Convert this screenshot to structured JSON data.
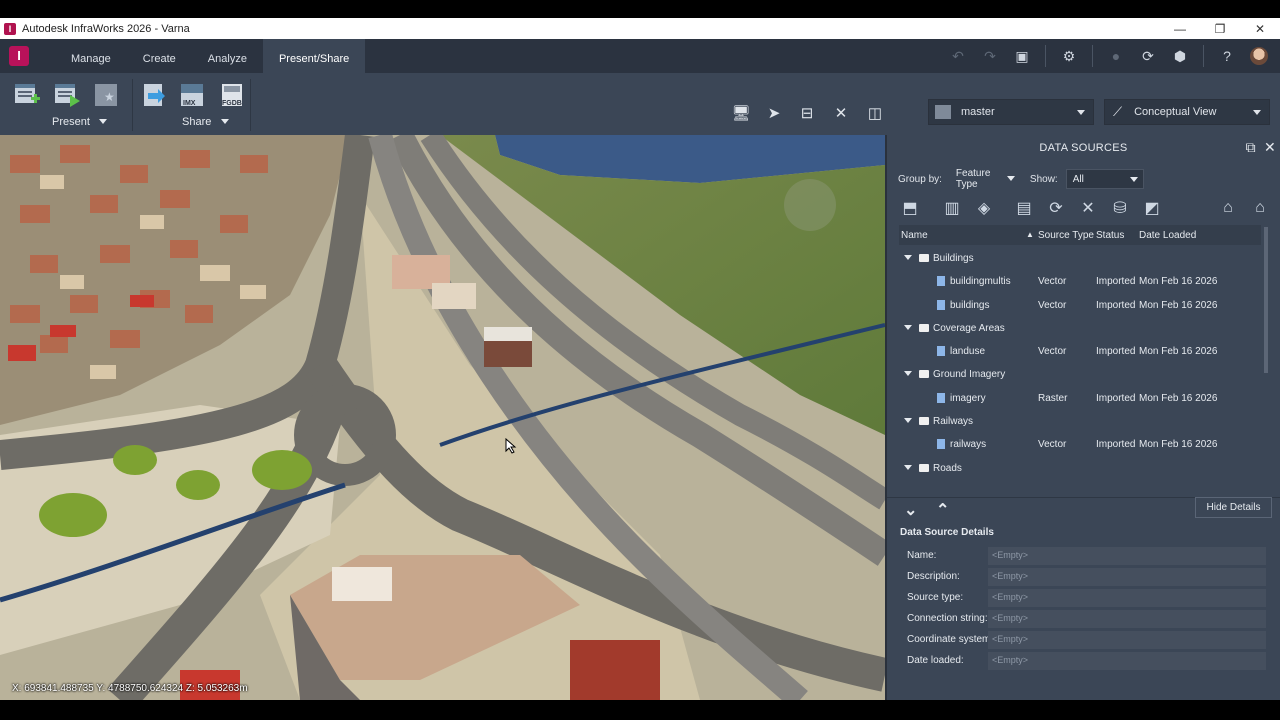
{
  "window": {
    "title": "Autodesk InfraWorks 2026 - Varna",
    "app_icon": "I",
    "controls": [
      "—",
      "❐",
      "✕"
    ]
  },
  "ribbon": {
    "logo": "I",
    "tabs": [
      {
        "label": "Manage"
      },
      {
        "label": "Create"
      },
      {
        "label": "Analyze"
      },
      {
        "label": "Present/Share"
      }
    ],
    "groups": {
      "present_label": "Present",
      "share_label": "Share",
      "imx_label": "IMX",
      "fgdb_label": "FGDB"
    },
    "branch": "master",
    "visual_style": "Conceptual View"
  },
  "viewport": {
    "coordinates": "X: 693841.488735 Y: 4788750.624324 Z: 5.053263m"
  },
  "data_sources": {
    "title": "DATA SOURCES",
    "group_by_label": "Group by:",
    "group_by_value": "Feature Type",
    "show_label": "Show:",
    "show_value": "All",
    "columns": {
      "name": "Name",
      "source_type": "Source Type",
      "status": "Status",
      "date_loaded": "Date Loaded"
    },
    "rows": [
      {
        "kind": "group",
        "name": "Buildings"
      },
      {
        "kind": "item",
        "name": "buildingmultis",
        "type": "Vector",
        "status": "Imported",
        "date": "Mon Feb 16 2026"
      },
      {
        "kind": "item",
        "name": "buildings",
        "type": "Vector",
        "status": "Imported",
        "date": "Mon Feb 16 2026"
      },
      {
        "kind": "group",
        "name": "Coverage Areas"
      },
      {
        "kind": "item",
        "name": "landuse",
        "type": "Vector",
        "status": "Imported",
        "date": "Mon Feb 16 2026"
      },
      {
        "kind": "group",
        "name": "Ground Imagery"
      },
      {
        "kind": "item",
        "name": "imagery",
        "type": "Raster",
        "status": "Imported",
        "date": "Mon Feb 16 2026"
      },
      {
        "kind": "group",
        "name": "Railways"
      },
      {
        "kind": "item",
        "name": "railways",
        "type": "Vector",
        "status": "Imported",
        "date": "Mon Feb 16 2026"
      },
      {
        "kind": "group",
        "name": "Roads"
      }
    ],
    "hide_details": "Hide Details",
    "details_title": "Data Source Details",
    "details": [
      {
        "label": "Name:",
        "value": "<Empty>"
      },
      {
        "label": "Description:",
        "value": "<Empty>"
      },
      {
        "label": "Source type:",
        "value": "<Empty>"
      },
      {
        "label": "Connection string:",
        "value": "<Empty>"
      },
      {
        "label": "Coordinate system:",
        "value": "<Empty>"
      },
      {
        "label": "Date loaded:",
        "value": "<Empty>"
      }
    ]
  }
}
